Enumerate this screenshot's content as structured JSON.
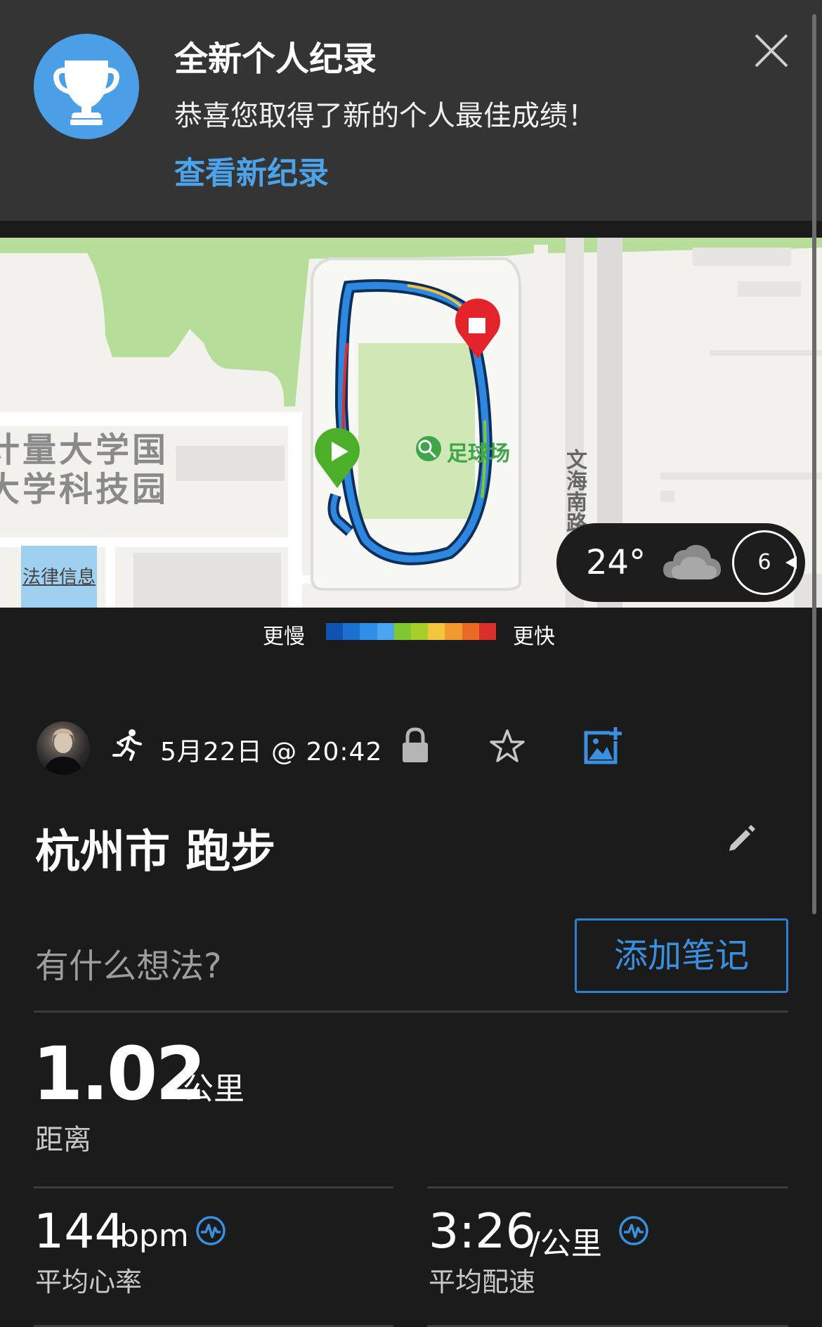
{
  "banner": {
    "title": "全新个人纪录",
    "subtitle": "恭喜您取得了新的个人最佳成绩！",
    "link": "查看新纪录",
    "accent_color": "#4a9fe6",
    "icon": "trophy-icon"
  },
  "map": {
    "campus_label_line1": "计量大学国",
    "campus_label_line2": "大学科技园",
    "field_label": "足球场",
    "road_label": "文海南路",
    "legal_link": "法律信息",
    "weather": {
      "temperature": "24°",
      "icon": "cloud-icon",
      "wind_speed": "6"
    }
  },
  "pace_legend": {
    "slow_label": "更慢",
    "fast_label": "更快",
    "colors": [
      "#1053b0",
      "#1d6fd0",
      "#2e8ee8",
      "#4aa6f0",
      "#7fc832",
      "#a6cf2c",
      "#f3c53b",
      "#f39a2f",
      "#ea6a23",
      "#d8302a"
    ]
  },
  "activity": {
    "date_time": "5月22日 @ 20:42",
    "title": "杭州市 跑步",
    "notes_prompt": "有什么想法?",
    "add_note_button": "添加笔记"
  },
  "stats": {
    "distance": {
      "value": "1.02",
      "unit": "公里",
      "label": "距离"
    },
    "heart_rate": {
      "value": "144",
      "unit": "bpm",
      "label": "平均心率"
    },
    "pace": {
      "value": "3:26",
      "unit": "/公里",
      "label": "平均配速"
    }
  }
}
